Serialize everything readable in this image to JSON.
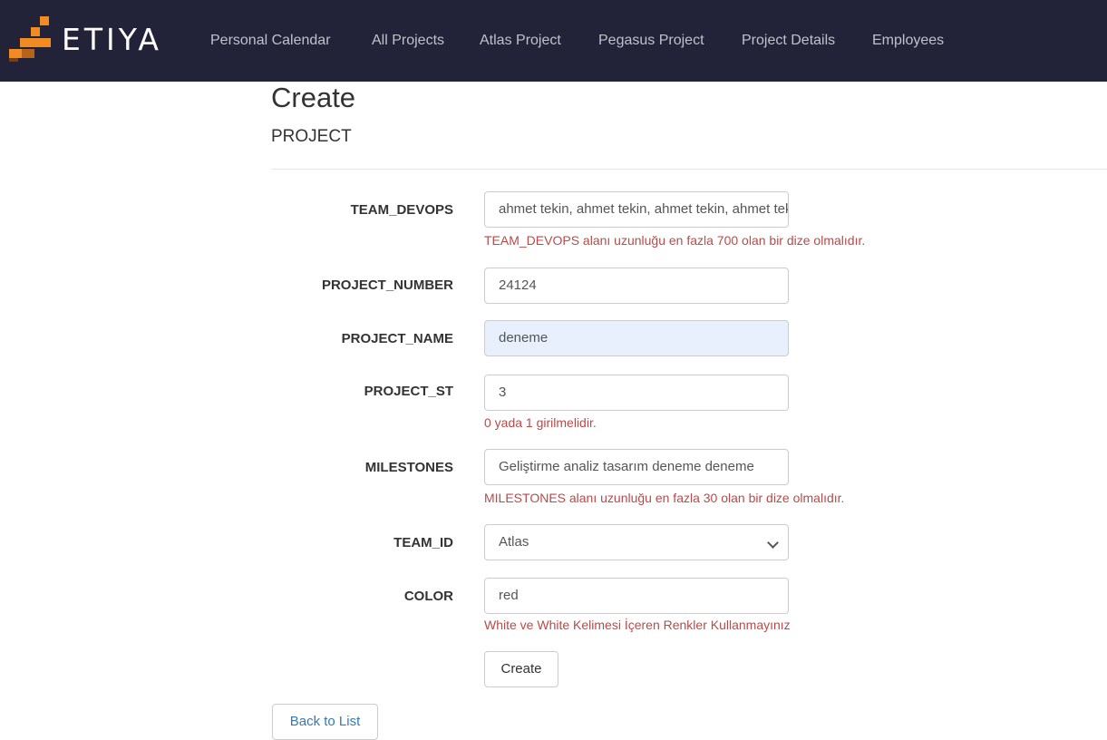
{
  "colors": {
    "navbar_bg": "#222338",
    "logo_orange": "#f28c22",
    "error_text": "#b94a48",
    "link_blue": "#337ab7",
    "autofill_bg": "#e8f0fe"
  },
  "brand": {
    "text": "ETIYA",
    "icon": "etiya-logo-icon"
  },
  "nav": {
    "items": [
      {
        "label": "Personal Calendar"
      },
      {
        "label": "All Projects"
      },
      {
        "label": "Atlas Project"
      },
      {
        "label": "Pegasus Project"
      },
      {
        "label": "Project Details"
      },
      {
        "label": "Employees"
      }
    ]
  },
  "page": {
    "title": "Create",
    "subtitle": "PROJECT"
  },
  "form": {
    "fields": [
      {
        "label": "TEAM_DEVOPS",
        "value": "ahmet tekin, ahmet tekin, ahmet tekin, ahmet tekin",
        "error": "TEAM_DEVOPS alanı uzunluğu en fazla 700 olan bir dize olmalıdır."
      },
      {
        "label": "PROJECT_NUMBER",
        "value": "24124"
      },
      {
        "label": "PROJECT_NAME",
        "value": "deneme"
      },
      {
        "label": "PROJECT_ST",
        "value": "3",
        "error": "0 yada 1 girilmelidir."
      },
      {
        "label": "MILESTONES",
        "value": "Geliştirme analiz tasarım deneme deneme",
        "error": "MILESTONES alanı uzunluğu en fazla 30 olan bir dize olmalıdır."
      },
      {
        "label": "TEAM_ID",
        "value": "Atlas",
        "icon": "chevron-down-icon"
      },
      {
        "label": "COLOR",
        "value": "red",
        "error": "White ve White Kelimesi İçeren Renkler Kullanmayınız"
      }
    ],
    "submit_label": "Create"
  },
  "back_link": "Back to List"
}
